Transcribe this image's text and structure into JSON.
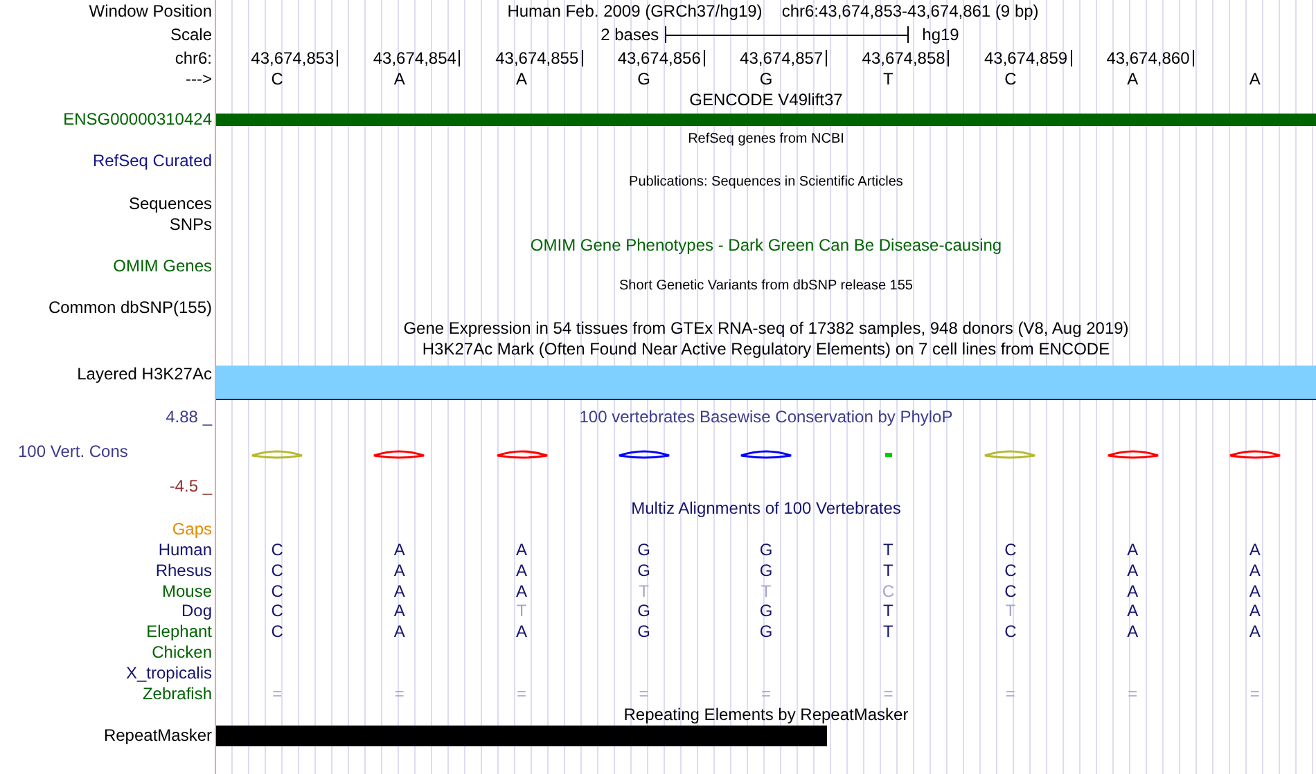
{
  "header": {
    "label": "Window Position",
    "assembly": "Human Feb. 2009 (GRCh37/hg19)",
    "position": "chr6:43,674,853-43,674,861 (9 bp)"
  },
  "scale": {
    "label": "Scale",
    "length": "2 bases",
    "assembly": "hg19"
  },
  "ruler": {
    "label": "chr6:",
    "positions": [
      "43,674,853",
      "43,674,854",
      "43,674,855",
      "43,674,856",
      "43,674,857",
      "43,674,858",
      "43,674,859",
      "43,674,860"
    ]
  },
  "sequence": {
    "label": "--->",
    "bases": [
      "C",
      "A",
      "A",
      "G",
      "G",
      "T",
      "C",
      "A",
      "A"
    ]
  },
  "rows": [
    {
      "kind": "title",
      "title": "GENCODE V49lift37",
      "small": false,
      "color": "#000000"
    },
    {
      "kind": "gene",
      "label": "ENSG00000310424",
      "color": "#006400"
    },
    {
      "kind": "title",
      "title": "RefSeq genes from NCBI",
      "small": true,
      "color": "#000000"
    },
    {
      "kind": "label",
      "label": "RefSeq Curated",
      "color": "#14148c"
    },
    {
      "kind": "title",
      "title": "Publications: Sequences in Scientific Articles",
      "small": true,
      "color": "#000000"
    },
    {
      "kind": "label",
      "label": "Sequences",
      "color": "#000000"
    },
    {
      "kind": "label",
      "label": "SNPs",
      "color": "#000000"
    },
    {
      "kind": "title",
      "title": "OMIM Gene Phenotypes - Dark Green Can Be Disease-causing",
      "small": false,
      "color": "#006400"
    },
    {
      "kind": "label",
      "label": "OMIM Genes",
      "color": "#006400"
    },
    {
      "kind": "title",
      "title": "Short Genetic Variants from dbSNP release 155",
      "small": true,
      "color": "#000000"
    },
    {
      "kind": "label",
      "label": "Common dbSNP(155)",
      "color": "#000000"
    },
    {
      "kind": "title",
      "title": "Gene Expression in 54 tissues from GTEx RNA-seq of 17382 samples, 948 donors (V8, Aug 2019)",
      "small": false,
      "color": "#000000"
    },
    {
      "kind": "title",
      "title": "H3K27Ac Mark (Often Found Near Active Regulatory Elements) on 7 cell lines from ENCODE",
      "small": false,
      "color": "#000000"
    },
    {
      "kind": "signal",
      "label": "Layered H3K27Ac",
      "color": "#000000"
    },
    {
      "kind": "axis",
      "label": "4.88 _",
      "title": "100 vertebrates Basewise Conservation by PhyloP",
      "color": "#3c3c8c"
    },
    {
      "kind": "conservation",
      "label": "100 Vert. Cons",
      "color": "#3c3c8c"
    },
    {
      "kind": "axis",
      "label": "-4.5 _",
      "color": "#8c3232"
    },
    {
      "kind": "title",
      "title": "Multiz Alignments of 100 Vertebrates",
      "small": false,
      "color": "#14146e"
    },
    {
      "kind": "label",
      "label": "Gaps",
      "color": "#e88a00"
    },
    {
      "kind": "alignment",
      "label": "Human",
      "color": "#14146e",
      "bases": [
        {
          "base": "C",
          "differs": false
        },
        {
          "base": "A",
          "differs": false
        },
        {
          "base": "A",
          "differs": false
        },
        {
          "base": "G",
          "differs": false
        },
        {
          "base": "G",
          "differs": false
        },
        {
          "base": "T",
          "differs": false
        },
        {
          "base": "C",
          "differs": false
        },
        {
          "base": "A",
          "differs": false
        },
        {
          "base": "A",
          "differs": false
        }
      ]
    },
    {
      "kind": "alignment",
      "label": "Rhesus",
      "color": "#14146e",
      "bases": [
        {
          "base": "C",
          "differs": false
        },
        {
          "base": "A",
          "differs": false
        },
        {
          "base": "A",
          "differs": false
        },
        {
          "base": "G",
          "differs": false
        },
        {
          "base": "G",
          "differs": false
        },
        {
          "base": "T",
          "differs": false
        },
        {
          "base": "C",
          "differs": false
        },
        {
          "base": "A",
          "differs": false
        },
        {
          "base": "A",
          "differs": false
        }
      ]
    },
    {
      "kind": "alignment",
      "label": "Mouse",
      "color": "#006400",
      "bases": [
        {
          "base": "C",
          "differs": false
        },
        {
          "base": "A",
          "differs": false
        },
        {
          "base": "A",
          "differs": false
        },
        {
          "base": "T",
          "differs": true
        },
        {
          "base": "T",
          "differs": true
        },
        {
          "base": "C",
          "differs": true
        },
        {
          "base": "C",
          "differs": false
        },
        {
          "base": "A",
          "differs": false
        },
        {
          "base": "A",
          "differs": false
        }
      ]
    },
    {
      "kind": "alignment",
      "label": "Dog",
      "color": "#14146e",
      "bases": [
        {
          "base": "C",
          "differs": false
        },
        {
          "base": "A",
          "differs": false
        },
        {
          "base": "T",
          "differs": true
        },
        {
          "base": "G",
          "differs": false
        },
        {
          "base": "G",
          "differs": false
        },
        {
          "base": "T",
          "differs": false
        },
        {
          "base": "T",
          "differs": true
        },
        {
          "base": "A",
          "differs": false
        },
        {
          "base": "A",
          "differs": false
        }
      ]
    },
    {
      "kind": "alignment",
      "label": "Elephant",
      "color": "#006400",
      "bases": [
        {
          "base": "C",
          "differs": false
        },
        {
          "base": "A",
          "differs": false
        },
        {
          "base": "A",
          "differs": false
        },
        {
          "base": "G",
          "differs": false
        },
        {
          "base": "G",
          "differs": false
        },
        {
          "base": "T",
          "differs": false
        },
        {
          "base": "C",
          "differs": false
        },
        {
          "base": "A",
          "differs": false
        },
        {
          "base": "A",
          "differs": false
        }
      ]
    },
    {
      "kind": "alignment",
      "label": "Chicken",
      "color": "#006400",
      "bases": []
    },
    {
      "kind": "alignment",
      "label": "X_tropicalis",
      "color": "#14146e",
      "bases": []
    },
    {
      "kind": "alignment",
      "label": "Zebrafish",
      "color": "#006400",
      "bases": [
        {
          "base": "=",
          "differs": true
        },
        {
          "base": "=",
          "differs": true
        },
        {
          "base": "=",
          "differs": true
        },
        {
          "base": "=",
          "differs": true
        },
        {
          "base": "=",
          "differs": true
        },
        {
          "base": "=",
          "differs": true
        },
        {
          "base": "=",
          "differs": true
        },
        {
          "base": "=",
          "differs": true
        },
        {
          "base": "=",
          "differs": true
        }
      ]
    },
    {
      "kind": "title",
      "title": "Repeating Elements by RepeatMasker",
      "small": false,
      "color": "#000000"
    },
    {
      "kind": "repeat",
      "label": "RepeatMasker",
      "color": "#000000"
    }
  ]
}
